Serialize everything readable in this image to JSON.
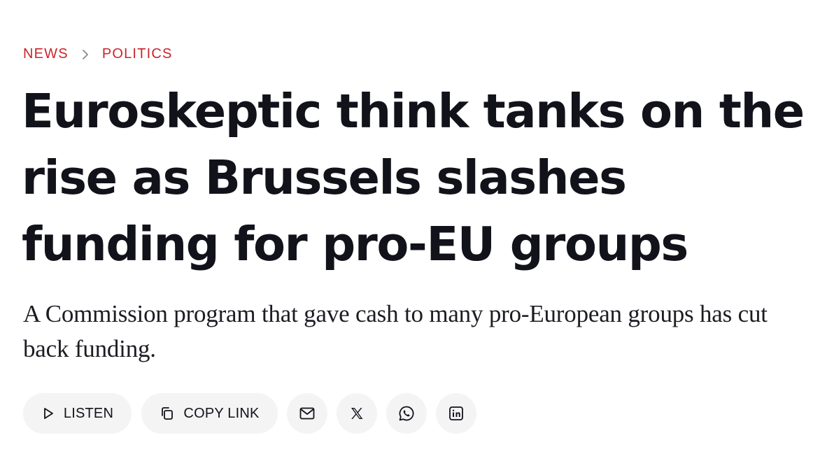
{
  "breadcrumb": {
    "items": [
      "NEWS",
      "POLITICS"
    ]
  },
  "article": {
    "headline": "Euroskeptic think tanks on the rise as Brussels slashes funding for pro-EU groups",
    "dek": "A Commission program that gave cash to many pro-European groups has cut back funding."
  },
  "share_bar": {
    "listen_label": "LISTEN",
    "copy_link_label": "COPY LINK",
    "icons": [
      "play-icon",
      "copy-icon",
      "mail-icon",
      "x-icon",
      "whatsapp-icon",
      "linkedin-icon"
    ]
  },
  "colors": {
    "accent": "#c8262c",
    "text": "#12121a",
    "pill_background": "#f4f4f5"
  }
}
